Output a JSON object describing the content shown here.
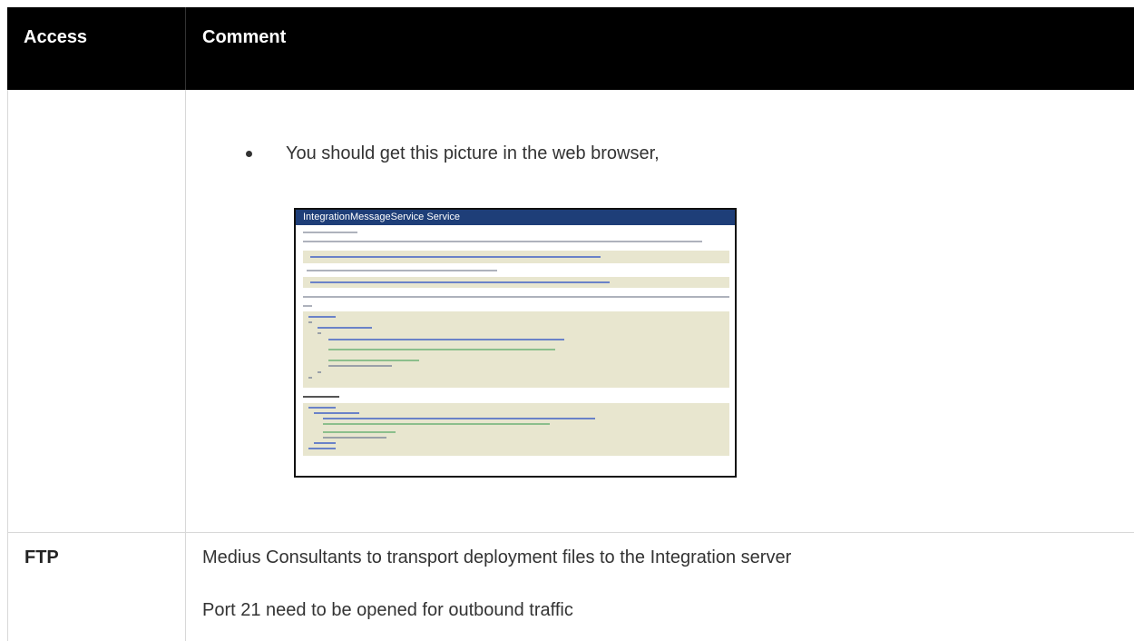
{
  "header": {
    "access": "Access",
    "comment": "Comment"
  },
  "rows": [
    {
      "access": "",
      "bullet": "You should get this picture in the web browser,",
      "screenshot": {
        "title": "IntegrationMessageService Service"
      }
    },
    {
      "access": "FTP",
      "comment_lines": [
        "Medius Consultants to transport deployment files to the Integration server",
        "Port 21 need to be opened for outbound traffic"
      ]
    }
  ],
  "colors": {
    "header_bg": "#000000",
    "header_text": "#ffffff",
    "screenshot_title_bg": "#1e3e78",
    "code_bg": "#e8e6cf"
  }
}
